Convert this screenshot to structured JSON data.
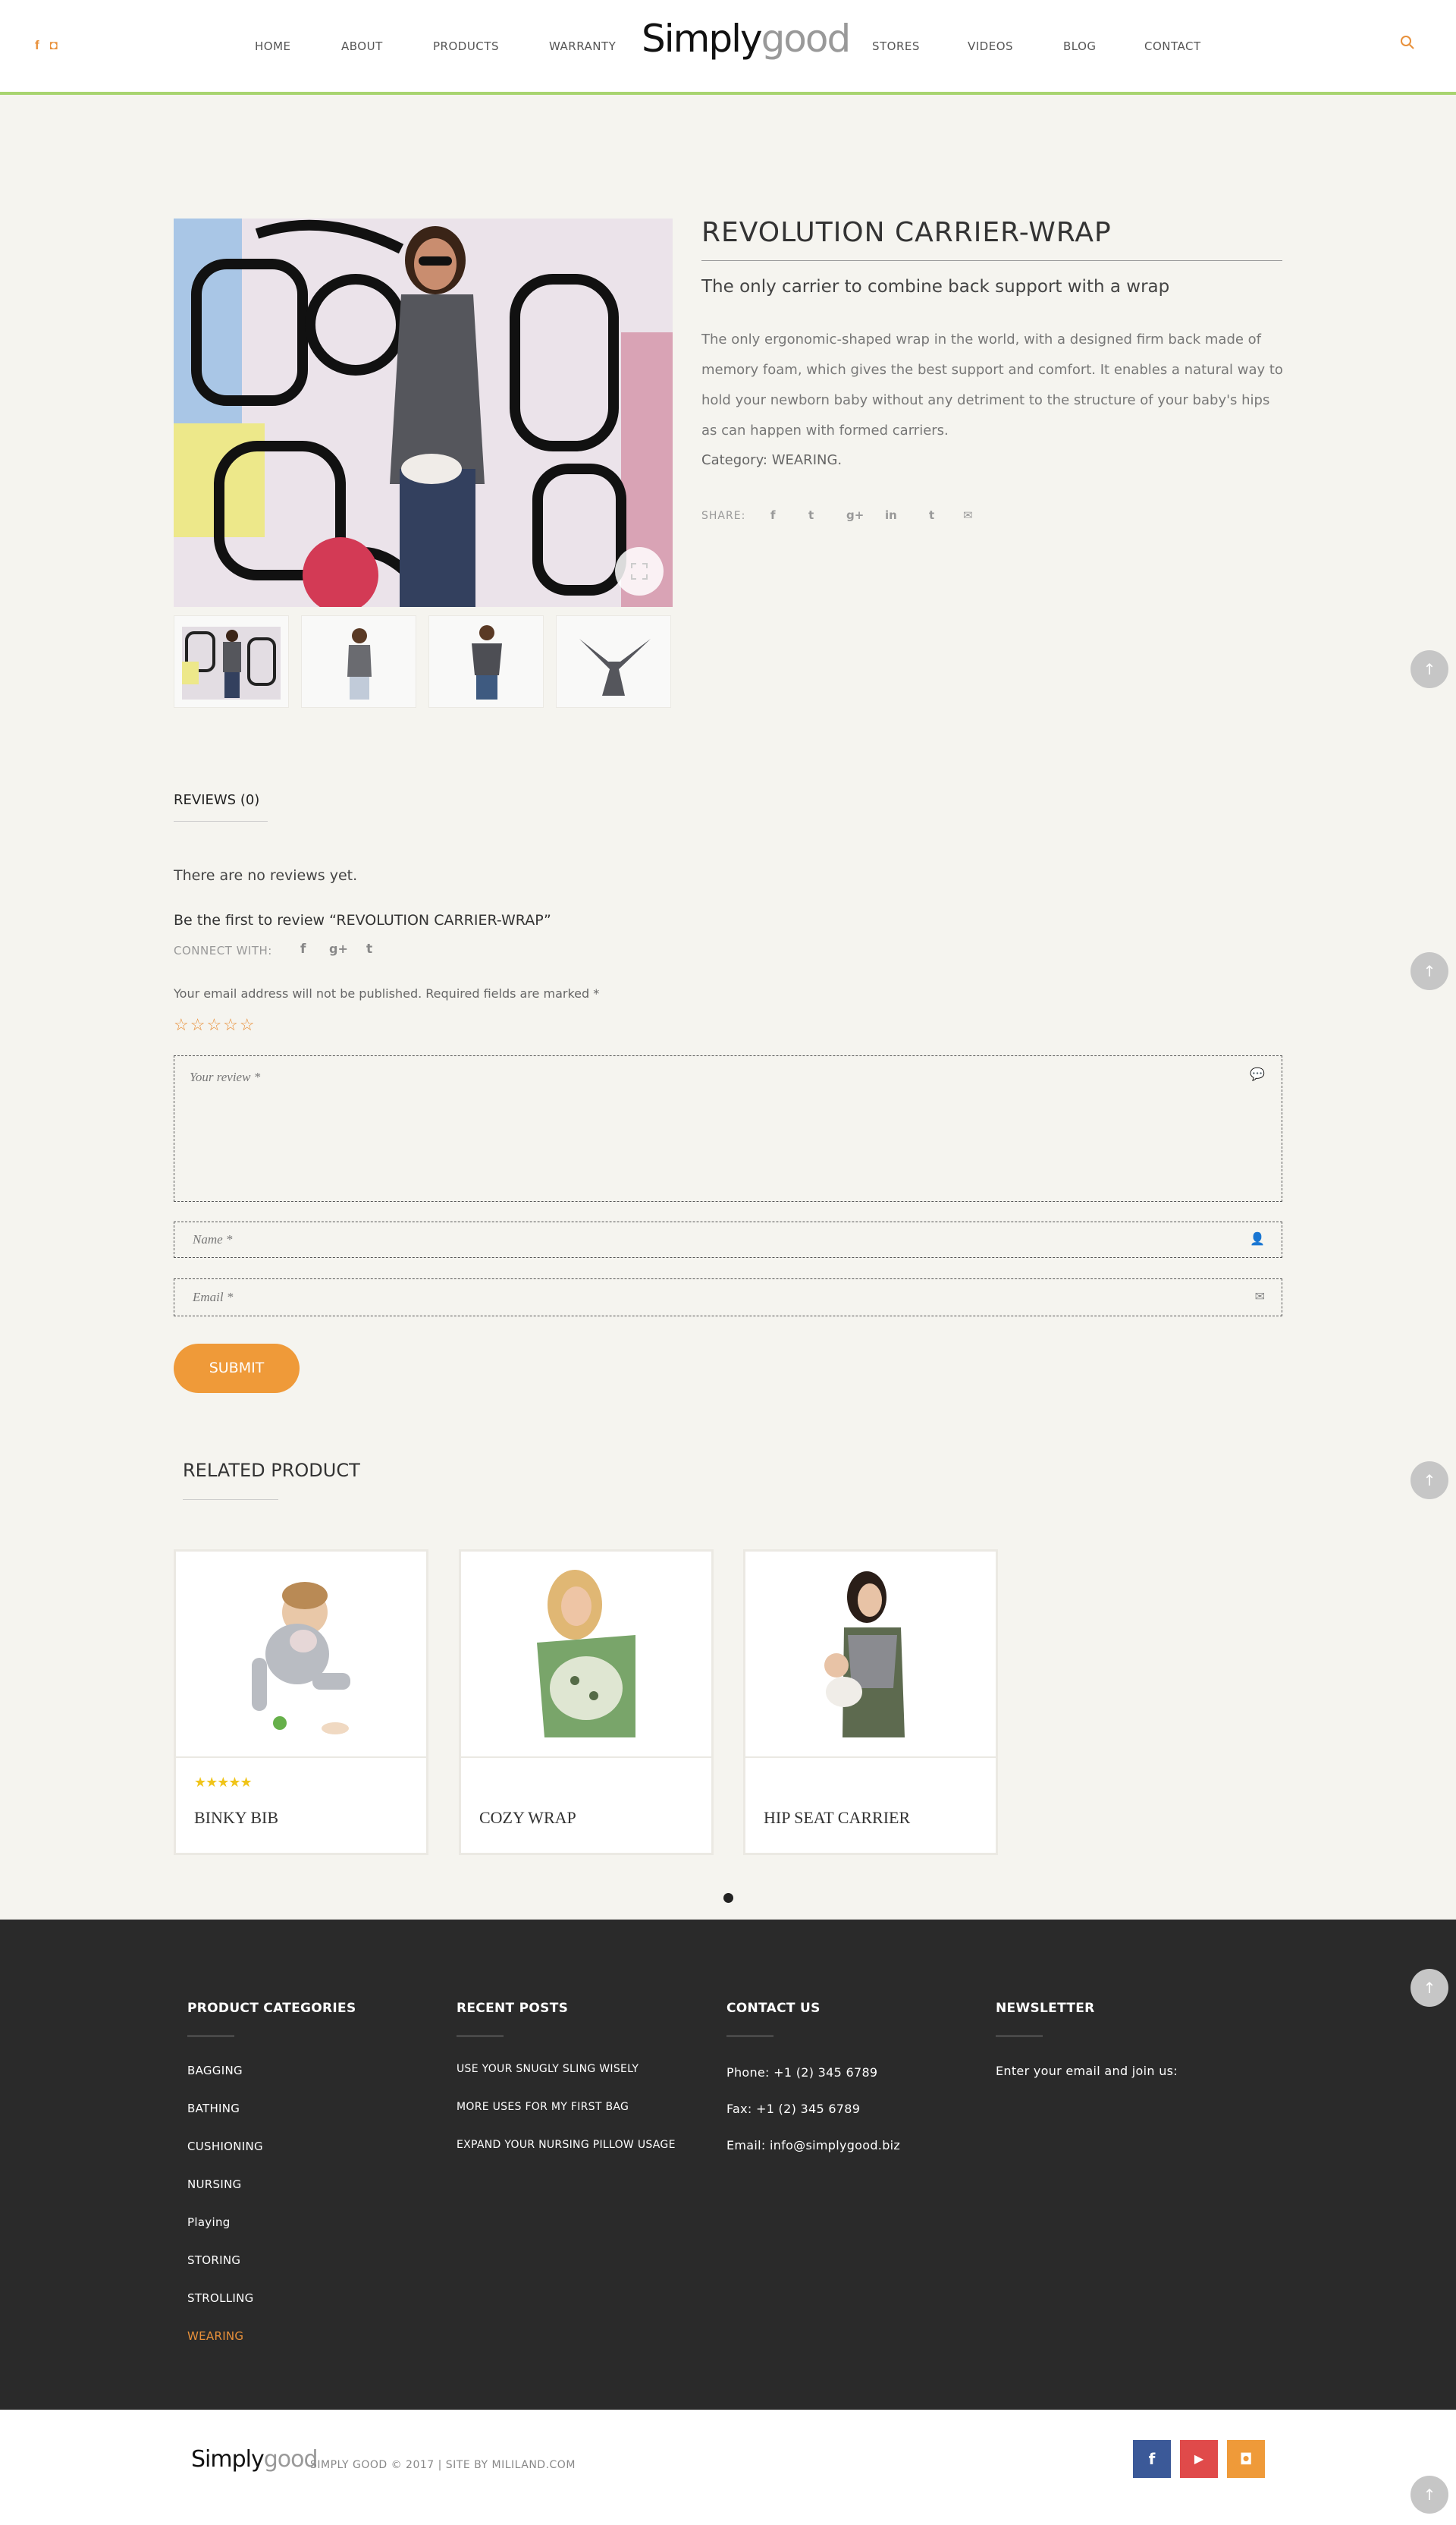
{
  "header": {
    "social": [
      "f",
      "◘"
    ],
    "nav_left": [
      "HOME",
      "ABOUT",
      "PRODUCTS",
      "WARRANTY"
    ],
    "nav_right": [
      "STORES",
      "VIDEOS",
      "BLOG",
      "CONTACT"
    ],
    "logo_a": "Simply",
    "logo_b": "good",
    "icons": {
      "search": "search-icon",
      "facebook": "facebook-icon",
      "instagram": "instagram-icon"
    }
  },
  "product": {
    "title": "REVOLUTION CARRIER-WRAP",
    "subtitle": "The only carrier to combine back support with a wrap",
    "description": "The only ergonomic-shaped wrap in the world, with a designed firm back made of memory foam, which gives the best support and comfort. It enables a natural way to hold your newborn baby without any detriment to the structure of your baby's hips as can happen with formed carriers.",
    "category": "Category: WEARING.",
    "share_label": "SHARE:",
    "share_icons": [
      "f",
      "t",
      "g+",
      "in",
      "t",
      "✉"
    ]
  },
  "reviews": {
    "tab": "REVIEWS (0)",
    "empty": "There are no reviews yet.",
    "first": "Be the first to review “REVOLUTION CARRIER-WRAP”",
    "connect": "CONNECT WITH:",
    "connect_icons": [
      "f",
      "g+",
      "t"
    ],
    "notice": "Your email address will not be published. Required fields are marked *",
    "rating_stars": "☆☆☆☆☆",
    "review_placeholder": "Your review *",
    "name_placeholder": "Name *",
    "email_placeholder": "Email *",
    "submit": "SUBMIT"
  },
  "related": {
    "title": "RELATED PRODUCT",
    "items": [
      {
        "name": "BINKY BIB",
        "stars": "★★★★★"
      },
      {
        "name": "COZY WRAP",
        "stars": ""
      },
      {
        "name": "HIP SEAT CARRIER",
        "stars": ""
      }
    ]
  },
  "footer": {
    "categories": {
      "heading": "PRODUCT CATEGORIES",
      "items": [
        "BAGGING",
        "BATHING",
        "CUSHIONING",
        "NURSING",
        "Playing",
        "STORING",
        "STROLLING",
        "WEARING"
      ]
    },
    "posts": {
      "heading": "RECENT POSTS",
      "items": [
        "USE YOUR SNUGLY SLING WISELY",
        "MORE USES FOR MY FIRST BAG",
        "EXPAND YOUR NURSING PILLOW USAGE"
      ]
    },
    "contact": {
      "heading": "CONTACT US",
      "phone": "Phone: +1 (2) 345 6789",
      "fax": "Fax: +1 (2) 345 6789",
      "email": "Email: info@simplygood.biz"
    },
    "newsletter": {
      "heading": "NEWSLETTER",
      "text": "Enter your email and join us:"
    },
    "copyright": "SIMPLY GOOD © 2017 | SITE BY MILILAND.COM",
    "social": [
      "f",
      "▶",
      "◘"
    ]
  },
  "colors": {
    "accent": "#ef9a39",
    "green_rule": "#a8d46f",
    "footer_bg": "#2a2a2a",
    "facebook": "#3b5998",
    "youtube": "#e04a4a",
    "instagram": "#ef9a39",
    "active_category": "#e8903a"
  },
  "scroll_top_symbol": "↑"
}
